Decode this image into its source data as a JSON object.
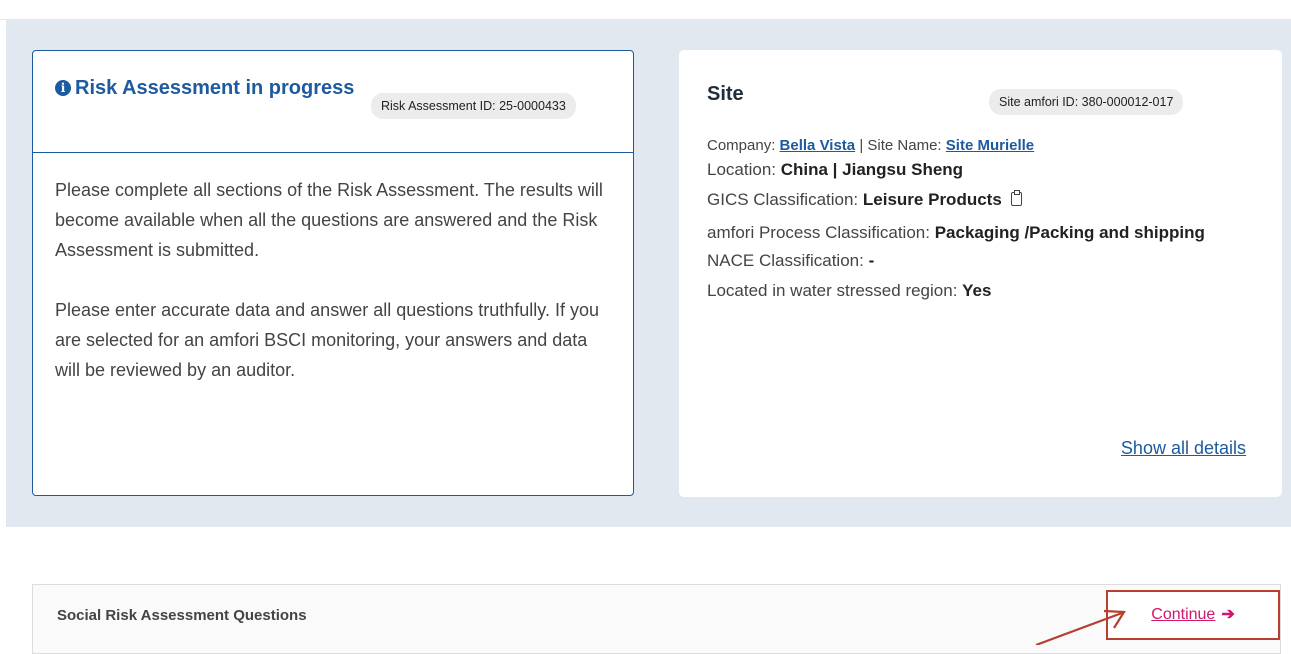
{
  "risk": {
    "title": "Risk Assessment in progress",
    "id_label": "Risk Assessment ID: 25-0000433",
    "paragraph1": "Please complete all sections of the Risk Assessment. The results will become available when all the questions are answered and the Risk Assessment is submitted.",
    "paragraph2": "Please enter accurate data and answer all questions truthfully. If you are selected for an amfori BSCI monitoring, your answers and data will be reviewed by an auditor."
  },
  "site": {
    "title": "Site",
    "id_label": "Site amfori ID: 380-000012-017",
    "company_label": "Company:",
    "company_value": "Bella Vista",
    "separator": "|",
    "site_name_label": "Site Name:",
    "site_name_value": "Site Murielle",
    "location_label": "Location:",
    "location_value": "China | Jiangsu Sheng",
    "gics_label": "GICS Classification:",
    "gics_value": "Leisure Products",
    "process_label": "amfori Process Classification:",
    "process_value": "Packaging /Packing and shipping",
    "nace_label": "NACE Classification:",
    "nace_value": "-",
    "water_label": "Located in water stressed region:",
    "water_value": "Yes",
    "show_all": "Show all details"
  },
  "section": {
    "label": "Social Risk Assessment Questions",
    "continue_label": "Continue",
    "continue_arrow": "➔"
  },
  "colors": {
    "primary": "#1d5a9f",
    "band": "#e1e8f0",
    "continue_text": "#d1176e",
    "highlight": "#b5402f"
  },
  "icons": {
    "info": "info-circle-icon",
    "clipboard": "clipboard-icon",
    "arrow": "arrow-right-icon"
  }
}
